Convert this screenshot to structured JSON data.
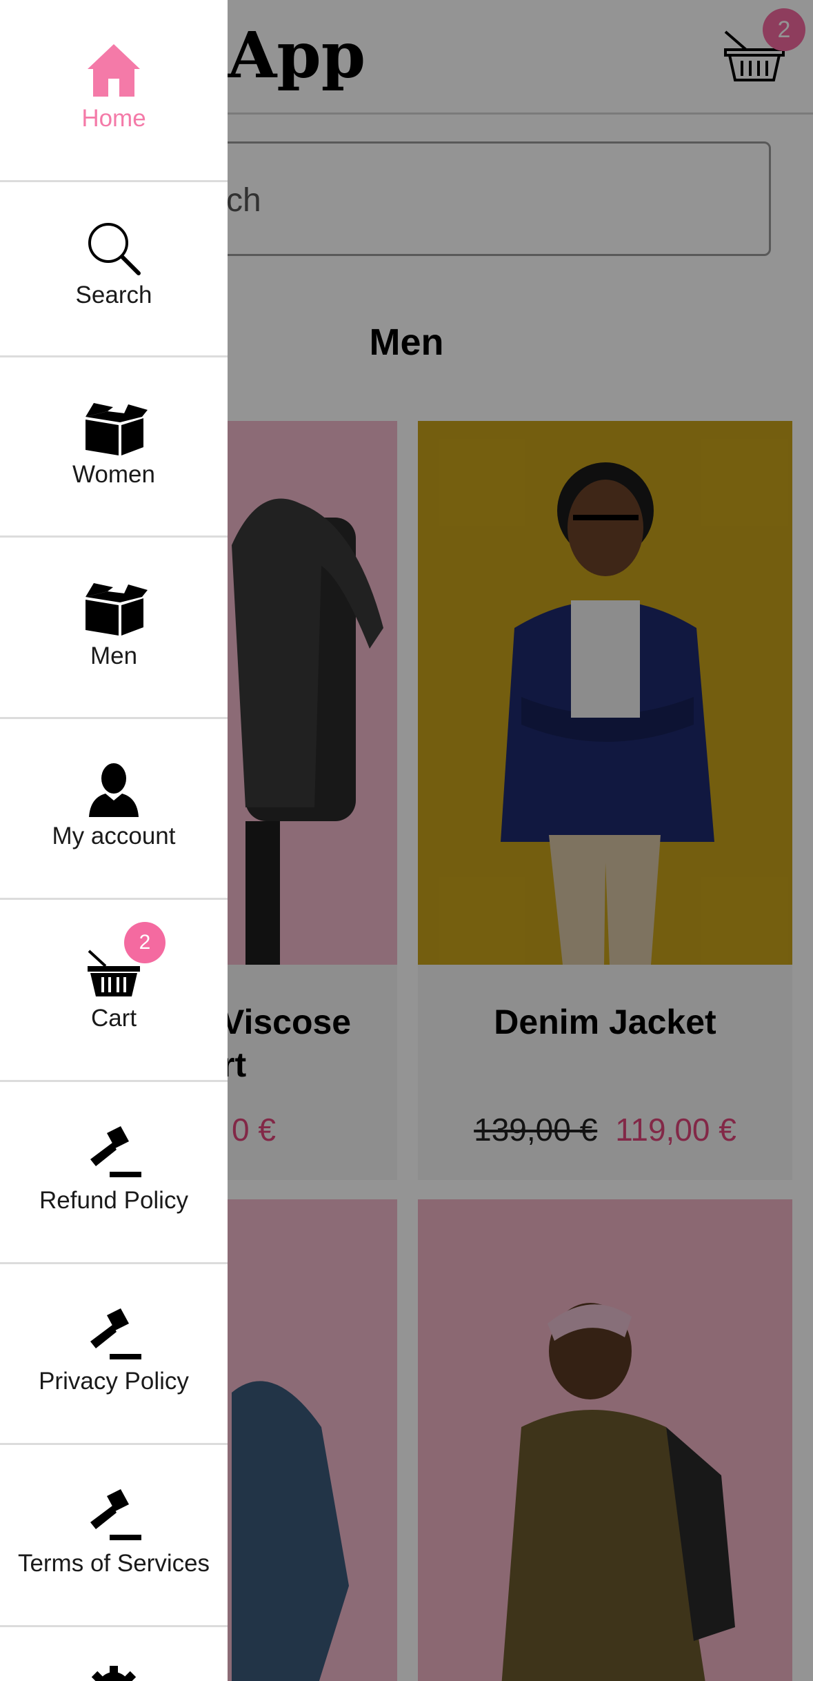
{
  "header": {
    "app_title": "App",
    "cart_badge": "2"
  },
  "search": {
    "placeholder_visible": "ch"
  },
  "section": {
    "title": "Men"
  },
  "products": [
    {
      "name_partial": "Viscose",
      "name_line2": "rt",
      "new_price_partial": "0 €"
    },
    {
      "name": "Denim Jacket",
      "old_price": "139,00 €",
      "new_price": "119,00 €"
    }
  ],
  "drawer": {
    "items": [
      {
        "label": "Home",
        "icon": "home-icon",
        "active": true
      },
      {
        "label": "Search",
        "icon": "search-icon"
      },
      {
        "label": "Women",
        "icon": "box-icon"
      },
      {
        "label": "Men",
        "icon": "box-icon"
      },
      {
        "label": "My account",
        "icon": "user-icon"
      },
      {
        "label": "Cart",
        "icon": "basket-icon",
        "badge": "2"
      },
      {
        "label": "Refund Policy",
        "icon": "gavel-icon"
      },
      {
        "label": "Privacy Policy",
        "icon": "gavel-icon"
      },
      {
        "label": "Terms of Services",
        "icon": "gavel-icon"
      },
      {
        "label": "",
        "icon": "gear-icon"
      }
    ]
  },
  "colors": {
    "accent": "#f46aa0",
    "active_menu": "#f47aa8",
    "sale_price": "#e0457b"
  }
}
